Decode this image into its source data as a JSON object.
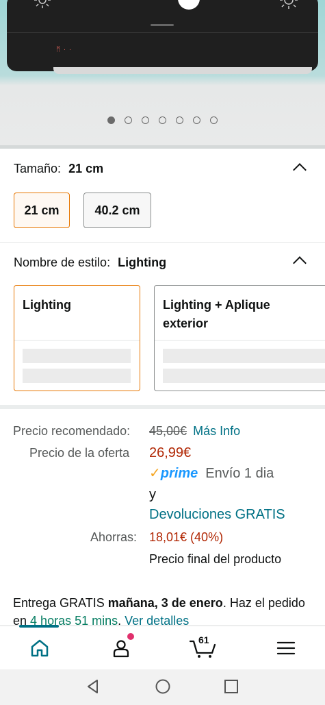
{
  "gallery": {
    "dots": [
      true,
      false,
      false,
      false,
      false,
      false,
      false
    ]
  },
  "size": {
    "label": "Tamaño:",
    "selected": "21 cm",
    "options": [
      "21 cm",
      "40.2 cm"
    ]
  },
  "style": {
    "label": "Nombre de estilo:",
    "selected": "Lighting",
    "options": [
      "Lighting",
      "Lighting + Aplique exterior"
    ]
  },
  "price": {
    "recommended_label": "Precio recomendado:",
    "recommended_value": "45,00€",
    "more_info": "Más Info",
    "offer_label": "Precio de la oferta",
    "offer_value": "26,99€",
    "prime_check": "✓",
    "prime_word": "prime",
    "shipping": "Envío 1 dia",
    "and": "y",
    "returns": "Devoluciones GRATIS",
    "savings_label": "Ahorras:",
    "savings_value": "18,01€ (40%)",
    "final_note": "Precio final del producto"
  },
  "delivery": {
    "prefix": "Entrega GRATIS",
    "date": "mañana, 3 de enero",
    "mid": ". Haz el pedido en",
    "countdown": "4 horas 51 mins",
    "details": "Ver detalles"
  },
  "bottom_nav": {
    "cart_count": "61",
    "items": [
      "home-icon",
      "account-icon",
      "cart-icon",
      "menu-icon"
    ]
  },
  "colors": {
    "accent_orange": "#e77600",
    "link_teal": "#007185",
    "price_red": "#b12704",
    "prime_blue": "#1a98ff"
  }
}
